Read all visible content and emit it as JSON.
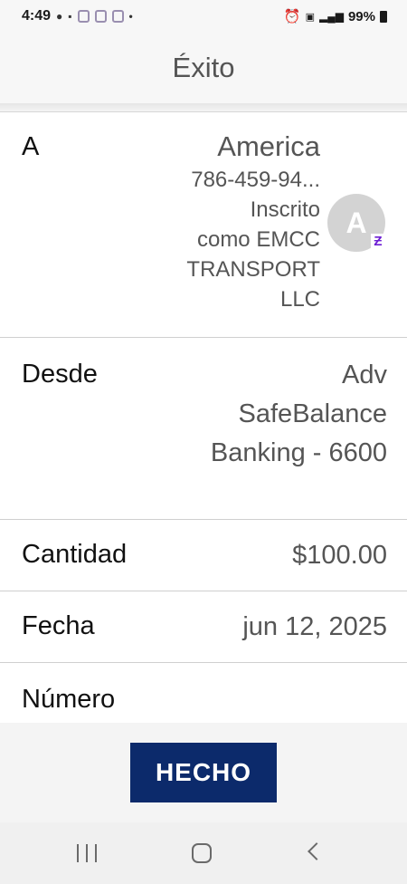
{
  "status_bar": {
    "time": "4:49",
    "battery": "99%"
  },
  "header": {
    "title": "Éxito"
  },
  "to": {
    "label": "A",
    "name": "America",
    "phone": "786-459-94...",
    "lines": [
      "Inscrito",
      "como EMCC",
      "TRANSPORT",
      "LLC"
    ],
    "avatar_initial": "A",
    "badge": "Ƶ"
  },
  "from": {
    "label": "Desde",
    "value_lines": [
      "Adv",
      "SafeBalance",
      "Banking - 6600"
    ]
  },
  "amount": {
    "label": "Cantidad",
    "value": "$100.00"
  },
  "date": {
    "label": "Fecha",
    "value": "jun 12, 2025"
  },
  "number": {
    "label": "Número"
  },
  "footer": {
    "done_label": "HECHO"
  },
  "colors": {
    "button": "#0c2a6b",
    "zelle_purple": "#6d1ed4"
  }
}
